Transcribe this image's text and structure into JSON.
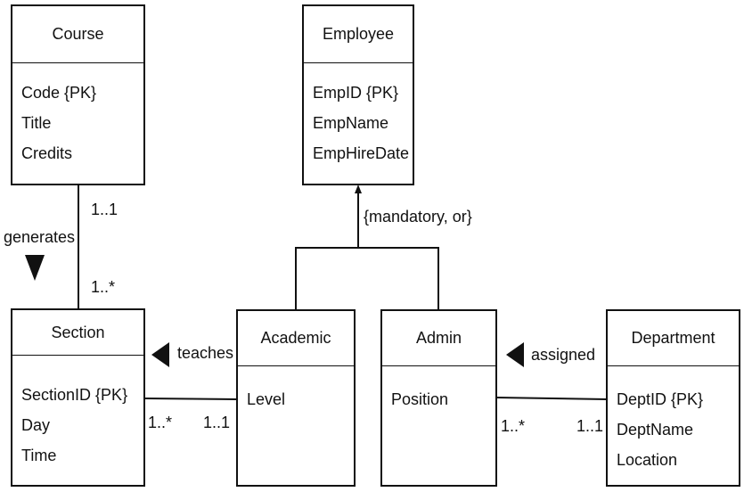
{
  "classes": {
    "course": {
      "name": "Course",
      "attributes": [
        "Code {PK}",
        "Title",
        "Credits"
      ]
    },
    "employee": {
      "name": "Employee",
      "attributes": [
        "EmpID {PK}",
        "EmpName",
        "EmpHireDate"
      ]
    },
    "section": {
      "name": "Section",
      "attributes": [
        "SectionID {PK}",
        "Day",
        "Time"
      ]
    },
    "academic": {
      "name": "Academic",
      "attributes": [
        "Level"
      ]
    },
    "admin": {
      "name": "Admin",
      "attributes": [
        "Position"
      ]
    },
    "department": {
      "name": "Department",
      "attributes": [
        "DeptID {PK}",
        "DeptName",
        "Location"
      ]
    }
  },
  "relationships": {
    "generates": {
      "label": "generates",
      "course_mult": "1..1",
      "section_mult": "1..*"
    },
    "teaches": {
      "label": "teaches",
      "section_mult": "1..*",
      "academic_mult": "1..1"
    },
    "assigned": {
      "label": "assigned",
      "admin_mult": "1..*",
      "department_mult": "1..1"
    },
    "generalization": {
      "constraint": "{mandatory, or}"
    }
  }
}
